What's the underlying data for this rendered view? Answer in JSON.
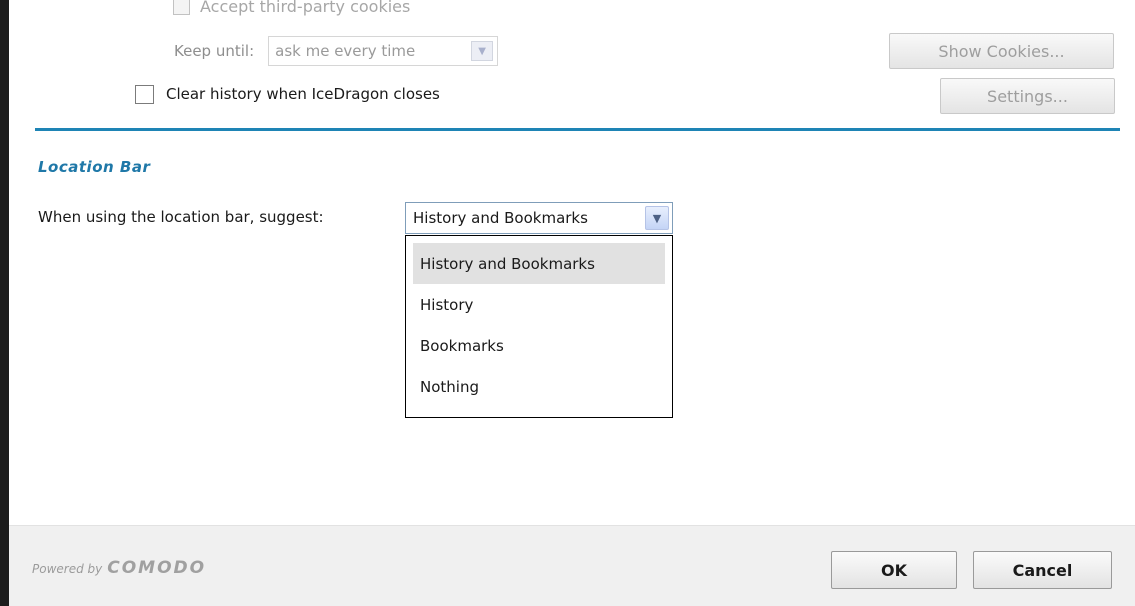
{
  "privacy": {
    "third_party_cookies_label": "Accept third-party cookies",
    "keep_until_label": "Keep until:",
    "keep_until_value": "ask me every time",
    "show_cookies_button": "Show Cookies...",
    "clear_history_label": "Clear history when IceDragon closes",
    "settings_button": "Settings..."
  },
  "location_bar": {
    "section_title": "Location Bar",
    "suggest_label": "When using the location bar, suggest:",
    "suggest_value": "History and Bookmarks",
    "options": [
      "History and Bookmarks",
      "History",
      "Bookmarks",
      "Nothing"
    ],
    "highlighted_option_index": 0
  },
  "footer": {
    "powered_by": "Powered by",
    "brand": "COMODO",
    "ok_button": "OK",
    "cancel_button": "Cancel"
  },
  "colors": {
    "accent": "#1e84b5",
    "section_title": "#1f78a8",
    "highlight": "#e1e1e1"
  }
}
